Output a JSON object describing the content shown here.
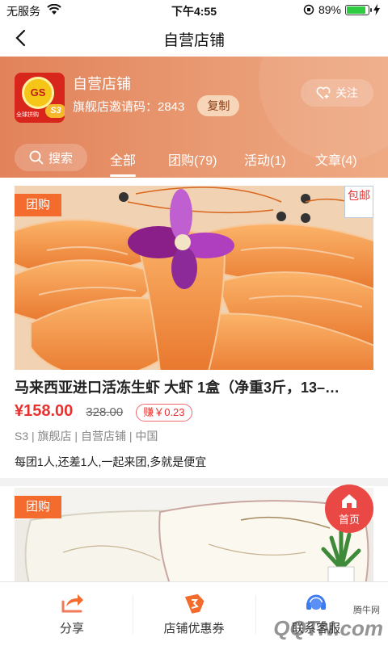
{
  "status_bar": {
    "carrier": "无服务",
    "time": "下午4:55",
    "battery": "89%",
    "battery_level": 0.89
  },
  "nav": {
    "title": "自营店铺"
  },
  "shop": {
    "name": "自营店铺",
    "invite_text": "旗舰店邀请码：2843",
    "copy_label": "复制",
    "follow_label": "关注",
    "logo_text": "全球拼购",
    "logo_badge": "S3"
  },
  "tabs": {
    "search_label": "搜索",
    "items": [
      {
        "label": "全部"
      },
      {
        "label": "团购(79)"
      },
      {
        "label": "活动(1)"
      },
      {
        "label": "文章(4)"
      }
    ]
  },
  "products": [
    {
      "badge": "团购",
      "free_shipping": "包邮",
      "title": "马来西亚进口活冻生虾 大虾 1盒（净重3斤，13–…",
      "price": "¥158.00",
      "old_price": "328.00",
      "earn": "赚￥0.23",
      "meta": "S3 | 旗舰店 | 自营店铺 | 中国",
      "desc": "每团1人,还差1人,一起来团,多就是便宜"
    },
    {
      "badge": "团购"
    }
  ],
  "fab": {
    "label": "首页"
  },
  "bottom_bar": {
    "items": [
      {
        "label": "分享"
      },
      {
        "label": "店铺优惠券"
      },
      {
        "label": "联系客服"
      }
    ]
  },
  "watermark": {
    "text": "QQTN.com",
    "small": "腾牛网"
  }
}
